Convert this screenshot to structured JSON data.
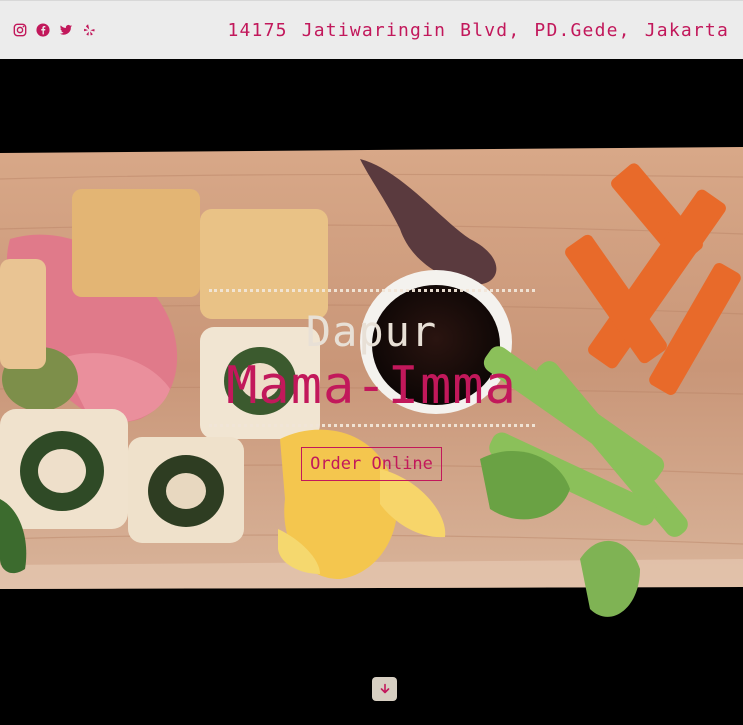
{
  "header": {
    "socials": [
      {
        "icon": "instagram-icon"
      },
      {
        "icon": "facebook-icon"
      },
      {
        "icon": "twitter-icon"
      },
      {
        "icon": "yelp-icon"
      }
    ],
    "address": "14175 Jatiwaringin Blvd, PD.Gede, Jakarta"
  },
  "hero": {
    "title_line1": "Dapur",
    "title_line2": "Mama-Imma",
    "order_button": "Order Online",
    "scroll_icon": "arrow-down-icon"
  },
  "colors": {
    "accent": "#c2185b",
    "topbar_bg": "#ececec",
    "hero_bg": "#000000"
  }
}
